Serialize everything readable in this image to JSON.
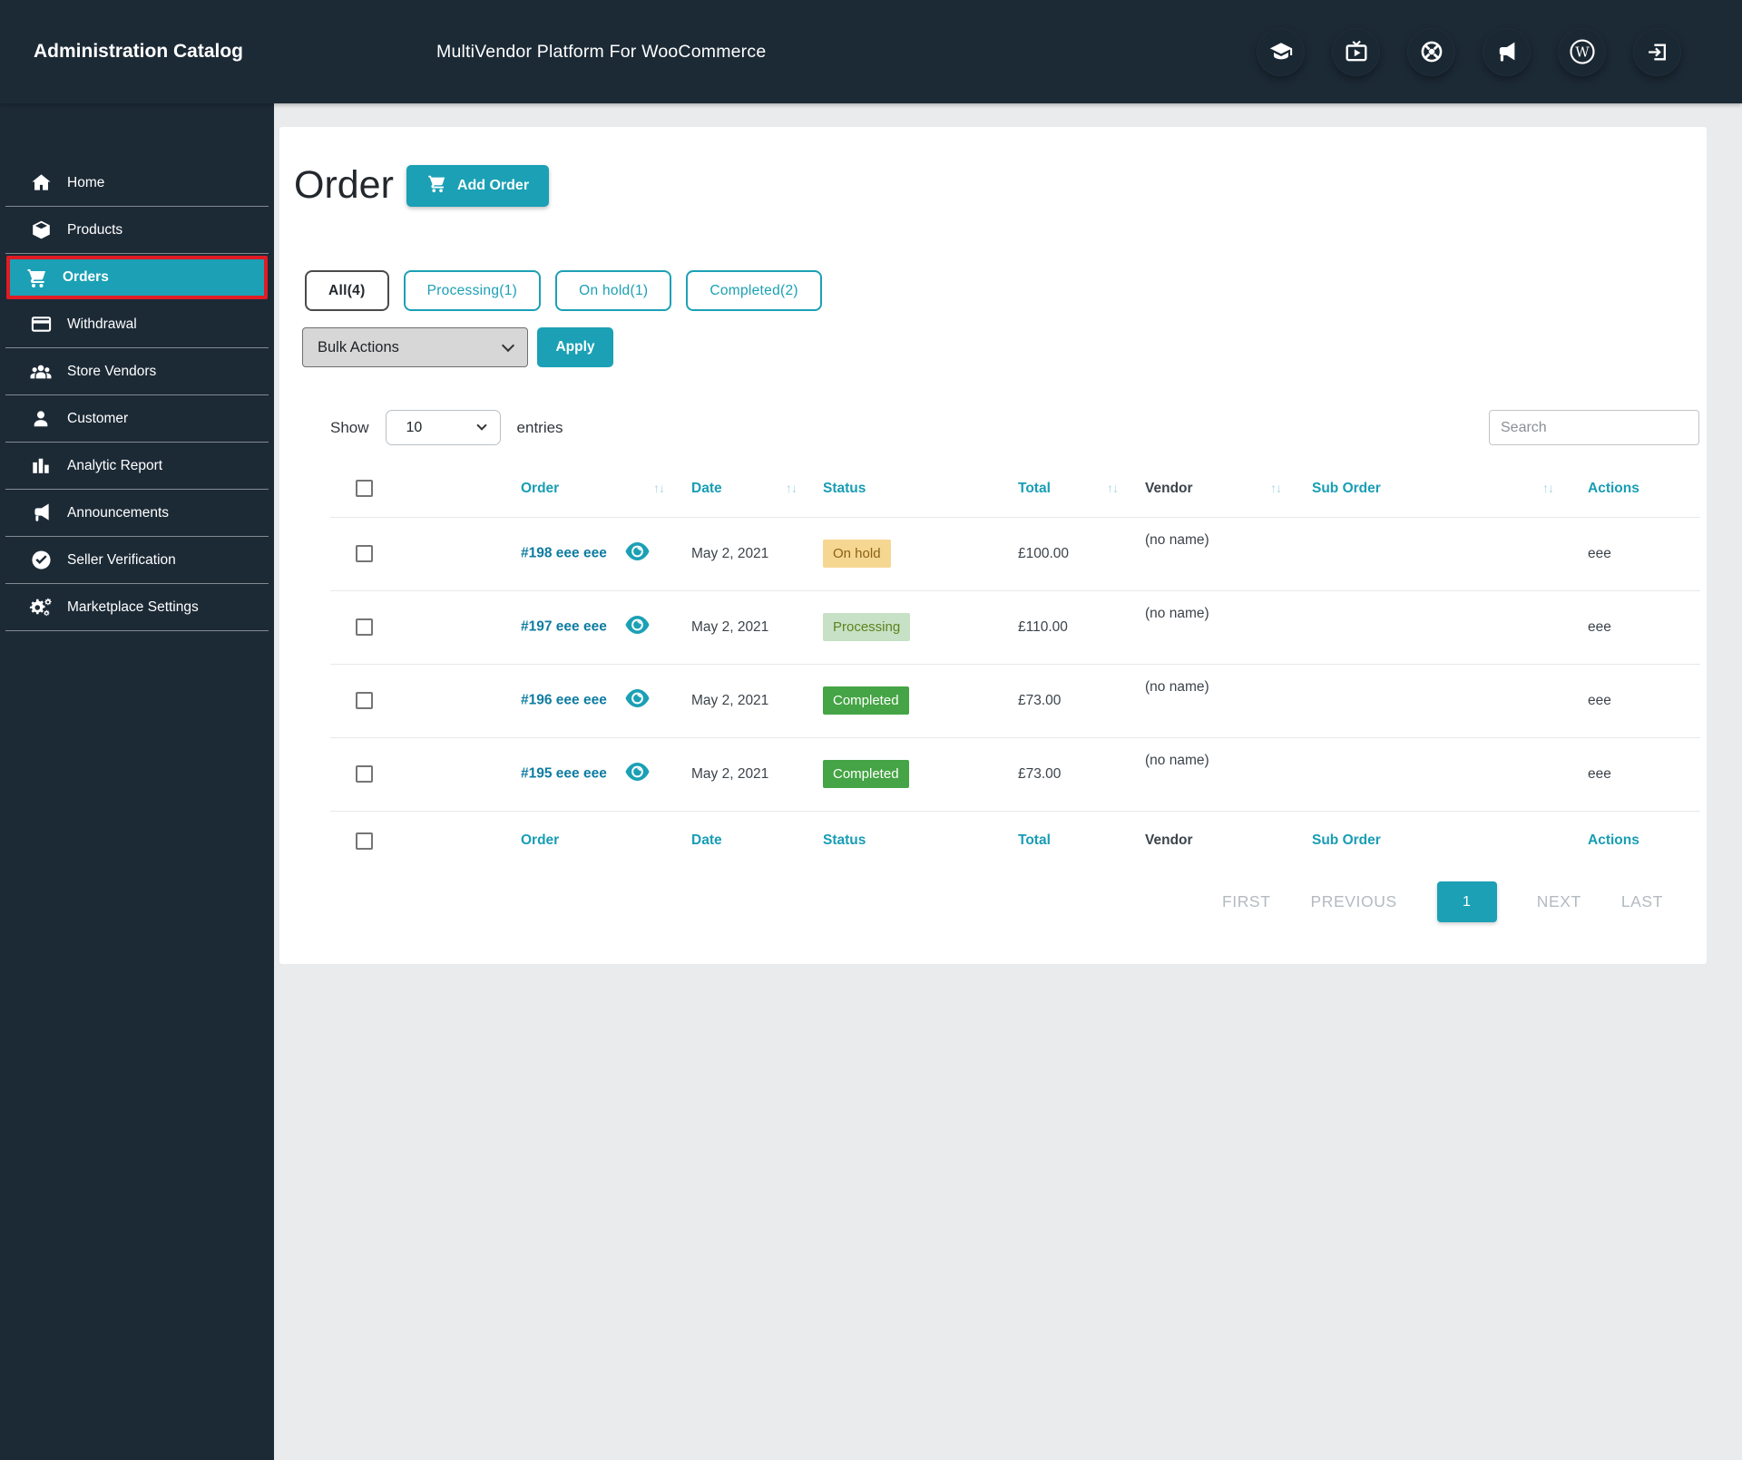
{
  "colors": {
    "accent": "#1ba0b5",
    "header_bg": "#1c2a36",
    "active_item_border": "#e01b24",
    "link": "#0e7ca1",
    "on_hold_bg": "#f6d792",
    "on_hold_text": "#8a6116",
    "processing_bg": "#c6e1c6",
    "processing_text": "#5b841b",
    "completed_bg": "#45a445",
    "completed_text": "#ffffff"
  },
  "header": {
    "logo": "Administration Catalog",
    "title": "MultiVendor Platform For WooCommerce",
    "icons": [
      "graduation-cap-icon",
      "tv-play-icon",
      "wheel-icon",
      "megaphone-icon",
      "wordpress-icon",
      "logout-icon"
    ]
  },
  "sidebar": {
    "items": [
      {
        "label": "Home",
        "icon": "home-icon"
      },
      {
        "label": "Products",
        "icon": "products-icon"
      },
      {
        "label": "Orders",
        "icon": "cart-icon",
        "active": true
      },
      {
        "label": "Withdrawal",
        "icon": "credit-card-icon"
      },
      {
        "label": "Store Vendors",
        "icon": "users-icon"
      },
      {
        "label": "Customer",
        "icon": "user-icon"
      },
      {
        "label": "Analytic Report",
        "icon": "bar-chart-icon"
      },
      {
        "label": "Announcements",
        "icon": "megaphone-icon"
      },
      {
        "label": "Seller Verification",
        "icon": "check-circle-icon"
      },
      {
        "label": "Marketplace Settings",
        "icon": "gears-icon"
      }
    ]
  },
  "page": {
    "title": "Order",
    "add_order": "Add Order"
  },
  "filters": [
    {
      "label": "All(4)",
      "active": true
    },
    {
      "label": "Processing(1)",
      "active": false
    },
    {
      "label": "On hold(1)",
      "active": false
    },
    {
      "label": "Completed(2)",
      "active": false
    }
  ],
  "bulk_actions": {
    "selected": "Bulk Actions",
    "apply": "Apply"
  },
  "list_controls": {
    "show": "Show",
    "page_size": "10",
    "entries": "entries",
    "search_placeholder": "Search"
  },
  "table": {
    "columns": [
      {
        "label": "Order",
        "sortable": true
      },
      {
        "label": "Date",
        "sortable": true
      },
      {
        "label": "Status",
        "sortable": false
      },
      {
        "label": "Total",
        "sortable": true
      },
      {
        "label": "Vendor",
        "sortable": true
      },
      {
        "label": "Sub Order",
        "sortable": true
      },
      {
        "label": "Actions",
        "sortable": false
      }
    ],
    "rows": [
      {
        "order": "#198 eee eee",
        "date": "May 2, 2021",
        "status": "On hold",
        "total": "£100.00",
        "vendor": "(no name)",
        "sub_order": "",
        "actions": "eee"
      },
      {
        "order": "#197 eee eee",
        "date": "May 2, 2021",
        "status": "Processing",
        "total": "£110.00",
        "vendor": "(no name)",
        "sub_order": "",
        "actions": "eee"
      },
      {
        "order": "#196 eee eee",
        "date": "May 2, 2021",
        "status": "Completed",
        "total": "£73.00",
        "vendor": "(no name)",
        "sub_order": "",
        "actions": "eee"
      },
      {
        "order": "#195 eee eee",
        "date": "May 2, 2021",
        "status": "Completed",
        "total": "£73.00",
        "vendor": "(no name)",
        "sub_order": "",
        "actions": "eee"
      }
    ]
  },
  "pagination": {
    "first": "FIRST",
    "previous": "PREVIOUS",
    "current": "1",
    "next": "NEXT",
    "last": "LAST"
  }
}
